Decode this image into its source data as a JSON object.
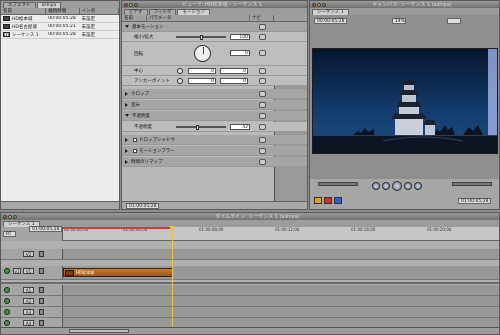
{
  "browser": {
    "title": "",
    "tabs": [
      "エフェクト",
      "ashiya"
    ],
    "columns": [
      "名前",
      "継続時間",
      "イン点"
    ],
    "rows": [
      {
        "name": "HD松本城",
        "duration": "00:00:05:28",
        "in": "未設定"
      },
      {
        "name": "HD名古屋城",
        "duration": "00:00:05:21",
        "in": "未設定"
      },
      {
        "name": "シーケンス 1",
        "duration": "00:00:05:28",
        "in": "未設定"
      }
    ]
  },
  "viewer": {
    "title": "ビューア: HD松本城 - シーケンス 1",
    "tabs": [
      "ビデオ",
      "フィルタ",
      "モーション"
    ],
    "columns": [
      "名前",
      "パラメータ",
      "ナビ"
    ],
    "rows": {
      "basic_motion": "基本モーション",
      "scale_label": "縮小/拡大",
      "scale_value": "100",
      "scale_level": 0.5,
      "rotation_label": "回転",
      "rotation_value": "0",
      "center_label": "中心",
      "center_x": "0",
      "center_y": "0",
      "anchor_label": "アンカーポイント",
      "anchor_x": "0",
      "anchor_y": "0",
      "crop": "クロップ",
      "distort": "歪み",
      "opacity_section": "不透明度",
      "opacity_label": "不透明度",
      "opacity_value": "42",
      "opacity_level": 0.42,
      "drop_shadow": "ドロップシャドウ",
      "motion_blur": "モーションブラー",
      "time_remap": "時間のリマップ"
    },
    "graph_value_top": "432",
    "graph_value_bottom": "-432",
    "footer_timecode": "01:00:05;28"
  },
  "canvas": {
    "title": "キャンバス: シーケンス 1 (ashiya)",
    "tabs": [
      "シーケンス 1"
    ],
    "duration": "00:00:05;28",
    "zoom": "14%",
    "timecode": "01:00:05;28"
  },
  "timeline": {
    "title": "タイムライン: シーケンス 1 (ashiya)",
    "tabs": [
      "シーケンス 1"
    ],
    "timecode": "01:00:05;28",
    "rt_label": "RT",
    "ruler": [
      "01:00:00;00",
      "01:00:04;00",
      "01:00:08;00",
      "01:00:12;00",
      "01:00:16;00",
      "01:00:20;00"
    ],
    "video_tracks": [
      "V2",
      "V1"
    ],
    "audio_tracks": [
      "A1",
      "A2",
      "A3",
      "A4"
    ],
    "source_video": "v1",
    "clip_label": "HD松本城"
  },
  "colors": {
    "playhead": "#e2c44a",
    "video_clip": "#c77b2f",
    "track_enabled": "#3a9a3a",
    "sky": "#0b1e3a"
  }
}
